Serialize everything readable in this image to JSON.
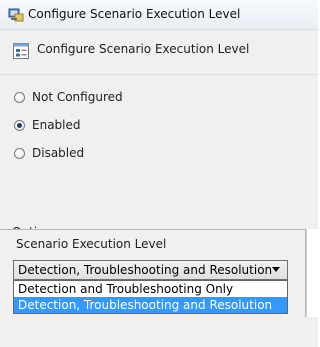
{
  "window": {
    "title": "Configure Scenario Execution Level",
    "icon": "group-policy-icon"
  },
  "header": {
    "title": "Configure Scenario Execution Level",
    "icon": "policy-setting-icon"
  },
  "state": {
    "options": [
      {
        "label": "Not Configured",
        "checked": false
      },
      {
        "label": "Enabled",
        "checked": true
      },
      {
        "label": "Disabled",
        "checked": false
      }
    ]
  },
  "options_section": {
    "label": "Options:",
    "level_label": "Scenario Execution Level",
    "select_value": "Detection, Troubleshooting and Resolution",
    "dropdown_items": [
      {
        "label": "Detection and Troubleshooting Only",
        "selected": false
      },
      {
        "label": "Detection, Troubleshooting and Resolution",
        "selected": true
      }
    ]
  },
  "colors": {
    "selection": "#3399ff",
    "background": "#f0f0f0"
  }
}
